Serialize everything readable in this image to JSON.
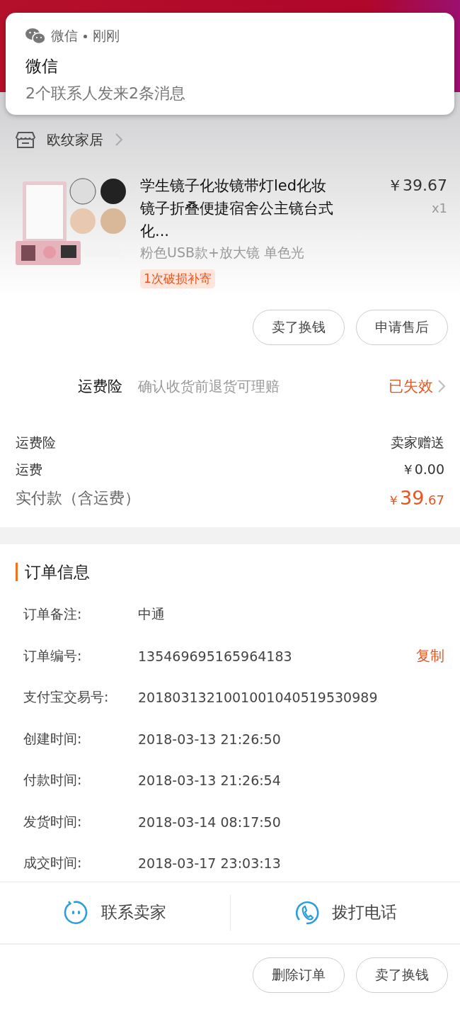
{
  "notification": {
    "app": "微信",
    "time": "刚刚",
    "title": "微信",
    "message": "2个联系人发来2条消息"
  },
  "shop": {
    "name": "欧纹家居"
  },
  "product": {
    "title": "学生镜子化妆镜带灯led化妆镜子折叠便捷宿舍公主镜台式化...",
    "price": "￥39.67",
    "quantity": "x1",
    "sku": "粉色USB款+放大镜  单色光",
    "tag": "1次破损补寄"
  },
  "item_actions": [
    "卖了换钱",
    "申请售后"
  ],
  "insurance": {
    "label": "运费险",
    "description": "确认收货前退货可理赔",
    "status": "已失效"
  },
  "fees": [
    {
      "label": "运费险",
      "value": "卖家赠送"
    },
    {
      "label": "运费",
      "value": "￥0.00"
    }
  ],
  "total": {
    "label": "实付款（含运费）",
    "currency": "￥",
    "integer": "39",
    "decimal": ".67"
  },
  "order_info": {
    "title": "订单信息",
    "copy": "复制",
    "rows": [
      {
        "label": "订单备注:",
        "value": "中通"
      },
      {
        "label": "订单编号:",
        "value": "135469695165964183",
        "copyable": true
      },
      {
        "label": "支付宝交易号:",
        "value": "2018031321001001040519530989",
        "copyable": false
      },
      {
        "label": "创建时间:",
        "value": "2018-03-13 21:26:50"
      },
      {
        "label": "付款时间:",
        "value": "2018-03-13 21:26:54"
      },
      {
        "label": "发货时间:",
        "value": "2018-03-14 08:17:50"
      },
      {
        "label": "成交时间:",
        "value": "2018-03-17 23:03:13"
      }
    ]
  },
  "contact": [
    {
      "kind": "chat",
      "label": "联系卖家"
    },
    {
      "kind": "phone",
      "label": "拨打电话"
    }
  ],
  "bottom_actions": [
    "删除订单",
    "卖了换钱"
  ]
}
